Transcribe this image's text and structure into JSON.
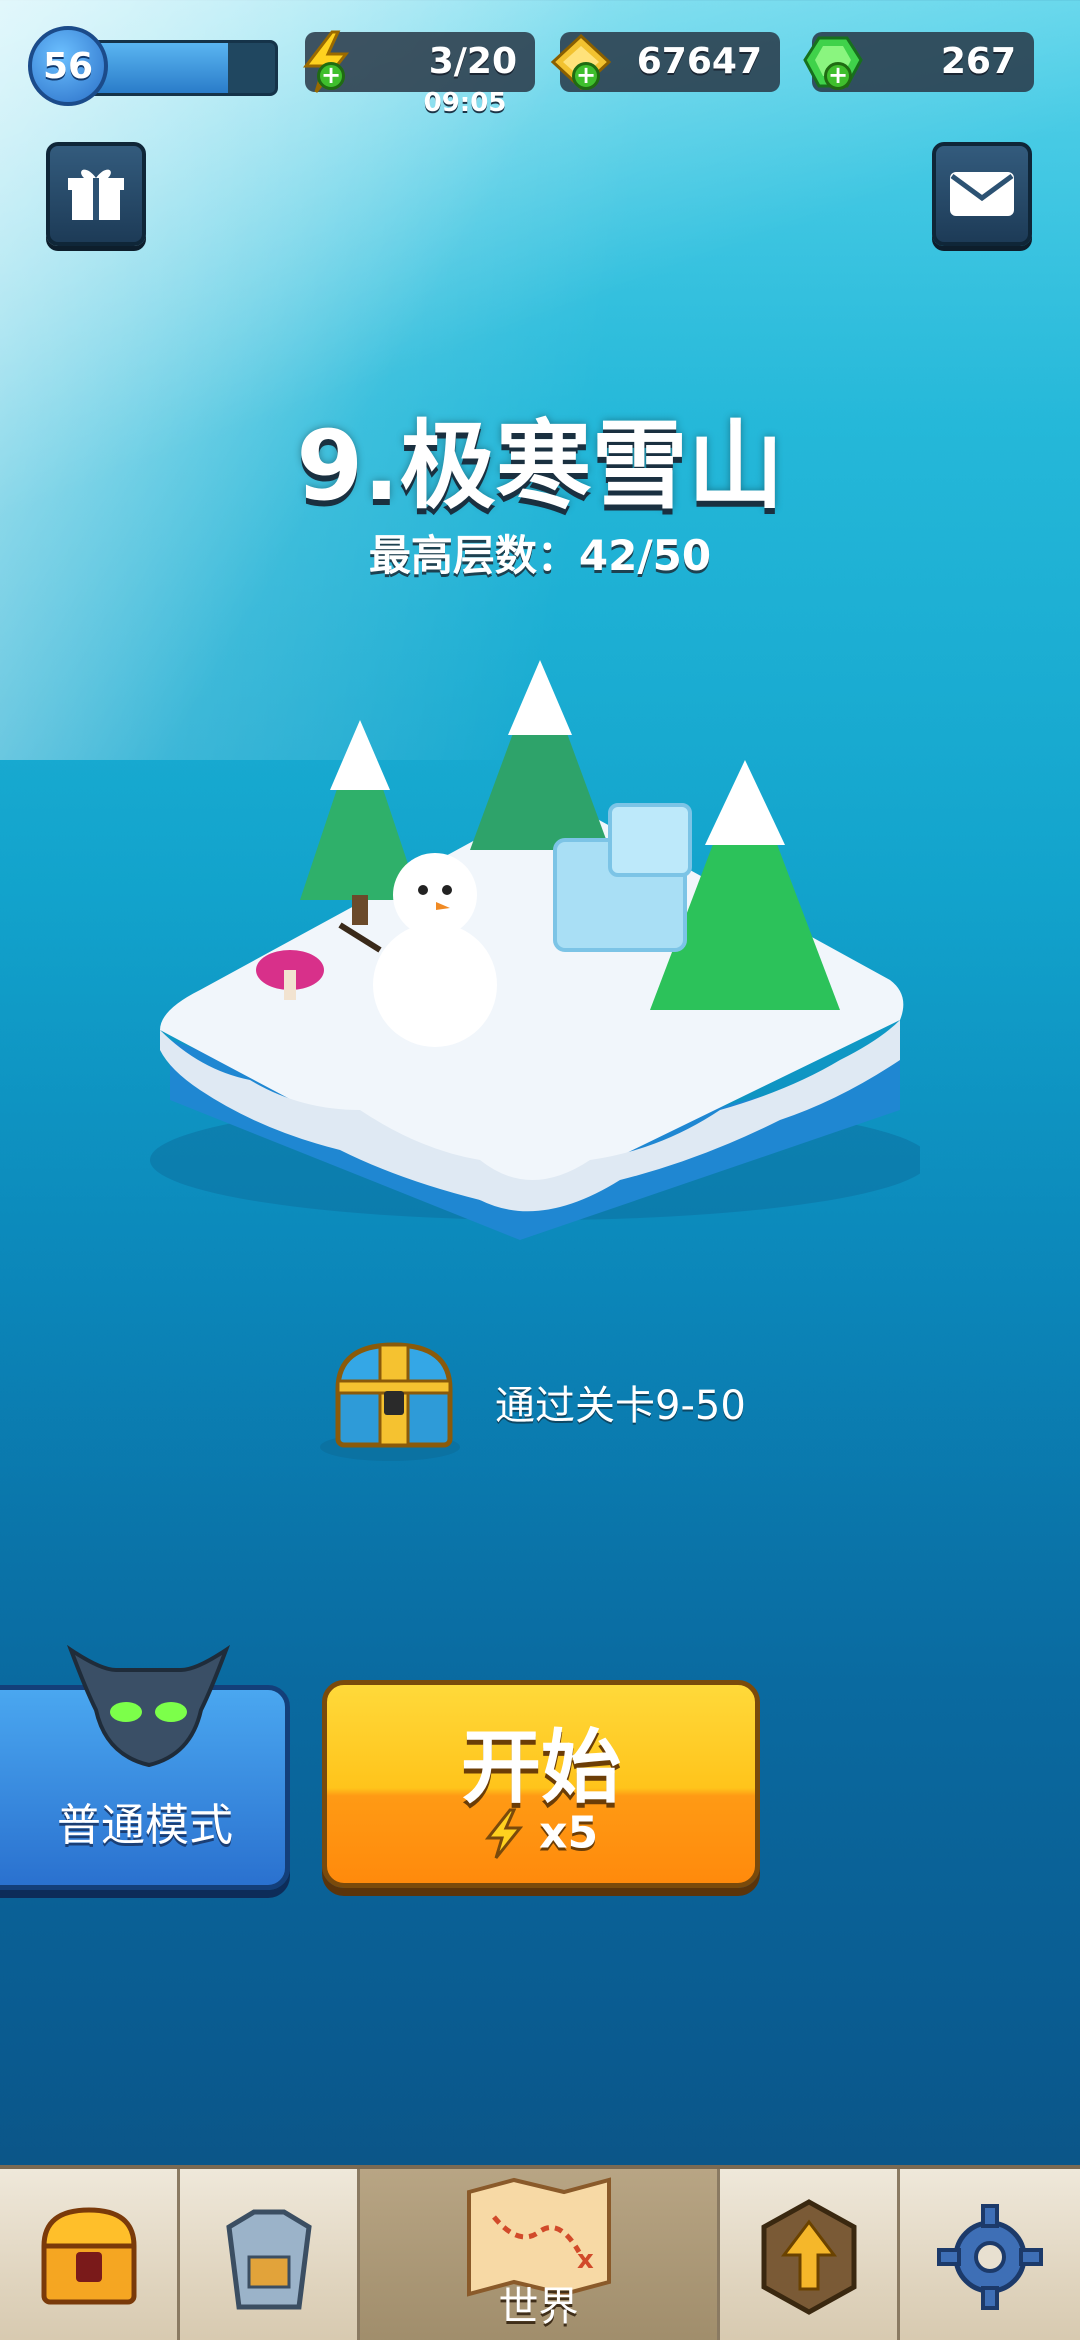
{
  "hud": {
    "level": "56",
    "level_progress": 0.75,
    "energy": "3/20",
    "energy_timer": "09:05",
    "gold": "67647",
    "gems": "267"
  },
  "stage": {
    "title": "9.极寒雪山",
    "best_floor": "最高层数：42/50"
  },
  "reward": {
    "condition": "通过关卡9-50"
  },
  "mode_button": {
    "label": "普通模式"
  },
  "start_button": {
    "label": "开始",
    "cost": "x5"
  },
  "nav": {
    "world_label": "世界"
  },
  "icons": [
    "gift-icon",
    "mail-icon",
    "lightning-icon",
    "gold-ingot-icon",
    "gem-icon",
    "chest-icon",
    "armor-icon",
    "map-icon",
    "upgrade-arrow-icon",
    "gear-icon",
    "demon-helmet-icon"
  ],
  "colors": {
    "start": "#ffc41b",
    "mode": "#3a8ee6",
    "gem": "#3fd24a",
    "energy": "#ffd21f"
  }
}
